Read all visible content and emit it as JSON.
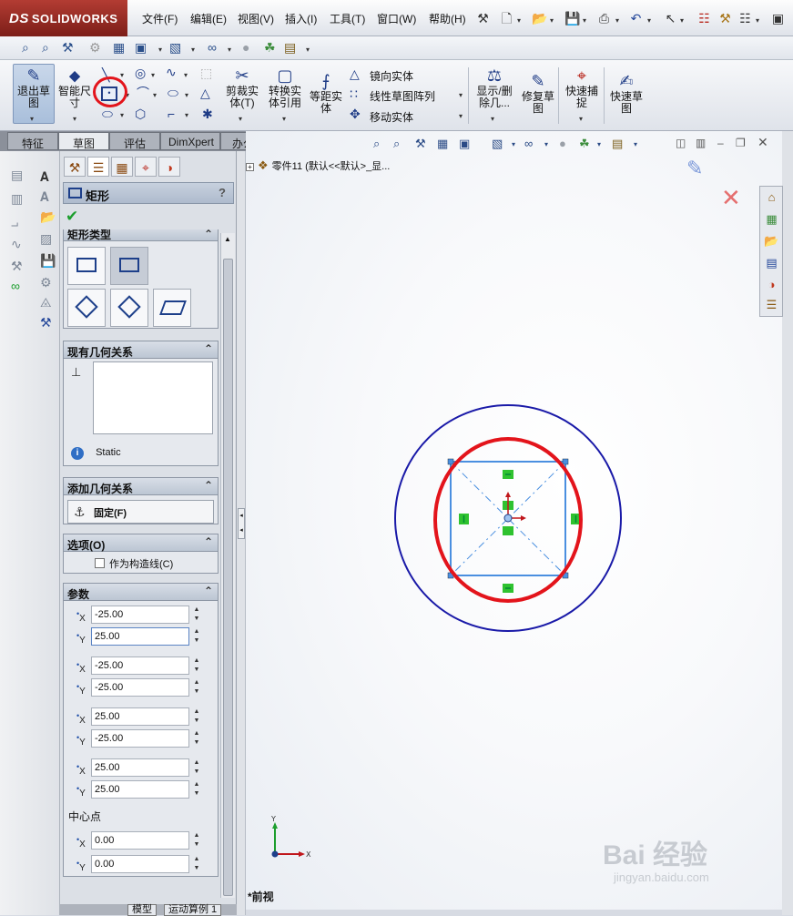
{
  "app": {
    "logo_prefix": "DS",
    "logo_text": "SOLIDWORKS"
  },
  "menu": [
    "文件(F)",
    "编辑(E)",
    "视图(V)",
    "插入(I)",
    "工具(T)",
    "窗口(W)",
    "帮助(H)"
  ],
  "command_manager": {
    "exit_sketch": "退出草\n图",
    "smart_dim": "智能尺\n寸",
    "trim": "剪裁实\n体(T)",
    "convert": "转换实\n体引用",
    "offset": "等距实\n体",
    "mirror": "镜向实体",
    "linear_pattern": "线性草图阵列",
    "move": "移动实体",
    "show_delete": "显示/删\n除几...",
    "repair": "修复草\n图",
    "quick_snap": "快速捕\n捉",
    "rapid_sketch": "快速草\n图"
  },
  "tabs": [
    "特征",
    "草图",
    "评估",
    "DimXpert",
    "办公室产品"
  ],
  "active_tab": "草图",
  "property_manager": {
    "title": "矩形",
    "help": "?",
    "rect_type_header": "矩形类型",
    "existing_relations_header": "现有几何关系",
    "status_text": "Static",
    "add_relations_header": "添加几何关系",
    "fix_label": "固定(F)",
    "options_header": "选项(O)",
    "construction_label": "作为构造线(C)",
    "params_header": "参数",
    "center_label": "中心点",
    "params": [
      {
        "axis": "X",
        "value": "-25.00"
      },
      {
        "axis": "Y",
        "value": "25.00"
      },
      {
        "axis": "X",
        "value": "-25.00"
      },
      {
        "axis": "Y",
        "value": "-25.00"
      },
      {
        "axis": "X",
        "value": "25.00"
      },
      {
        "axis": "Y",
        "value": "-25.00"
      },
      {
        "axis": "X",
        "value": "25.00"
      },
      {
        "axis": "Y",
        "value": "25.00"
      }
    ],
    "center": [
      {
        "axis": "X",
        "value": "0.00"
      },
      {
        "axis": "Y",
        "value": "0.00"
      }
    ]
  },
  "feature_tree": {
    "root": "零件11  (默认<<默认>_显..."
  },
  "graphics": {
    "view_name": "*前视",
    "triad_x": "X",
    "triad_y": "Y",
    "annotation_color": "#e3141b",
    "sketch_color": "#4a8fe0",
    "circle_color": "#1a1aa8"
  },
  "bottom_tabs": [
    "模型",
    "运动算例 1"
  ],
  "watermark": {
    "main": "Bai 经验",
    "sub": "jingyan.baidu.com"
  }
}
